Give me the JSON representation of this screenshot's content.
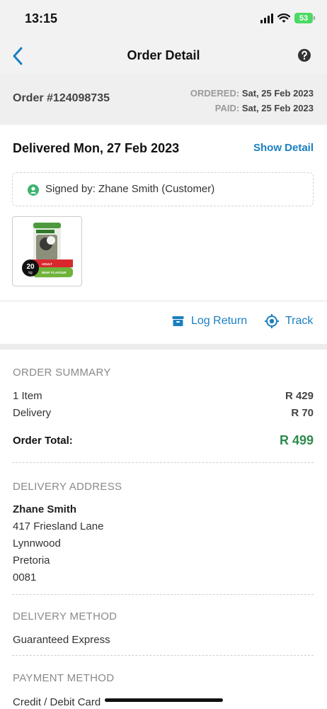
{
  "status_bar": {
    "time": "13:15",
    "battery": "53"
  },
  "nav": {
    "title": "Order Detail",
    "back_icon": "chevron-left-icon",
    "help_icon": "question-circle-icon"
  },
  "order": {
    "number": "Order #124098735",
    "ordered_label": "ORDERED:",
    "ordered_date": "Sat, 25 Feb 2023",
    "paid_label": "PAID:",
    "paid_date": "Sat, 25 Feb 2023"
  },
  "delivery": {
    "status": "Delivered Mon, 27 Feb 2023",
    "show_detail": "Show Detail",
    "signed_by": "Signed by: Zhane Smith (Customer)"
  },
  "product": {
    "weight": "20",
    "weight_unit": "kg",
    "pack_label_1": "ADULT",
    "pack_label_2": "BEEF FLAVOUR"
  },
  "actions": {
    "log_return": "Log Return",
    "track": "Track"
  },
  "summary": {
    "heading": "ORDER SUMMARY",
    "items_label": "1 Item",
    "items_value": "R 429",
    "delivery_label": "Delivery",
    "delivery_value": "R 70",
    "total_label": "Order Total:",
    "total_value": "R 499"
  },
  "address": {
    "heading": "DELIVERY ADDRESS",
    "name": "Zhane Smith",
    "line1": "417 Friesland Lane",
    "line2": "Lynnwood",
    "line3": "Pretoria",
    "line4": "0081"
  },
  "delivery_method": {
    "heading": "DELIVERY METHOD",
    "value": "Guaranteed Express"
  },
  "payment_method": {
    "heading": "PAYMENT METHOD",
    "value": "Credit / Debit Card"
  },
  "colors": {
    "accent_blue": "#1a7fc1",
    "total_green": "#2e8b4e",
    "signed_green": "#3cb371"
  }
}
